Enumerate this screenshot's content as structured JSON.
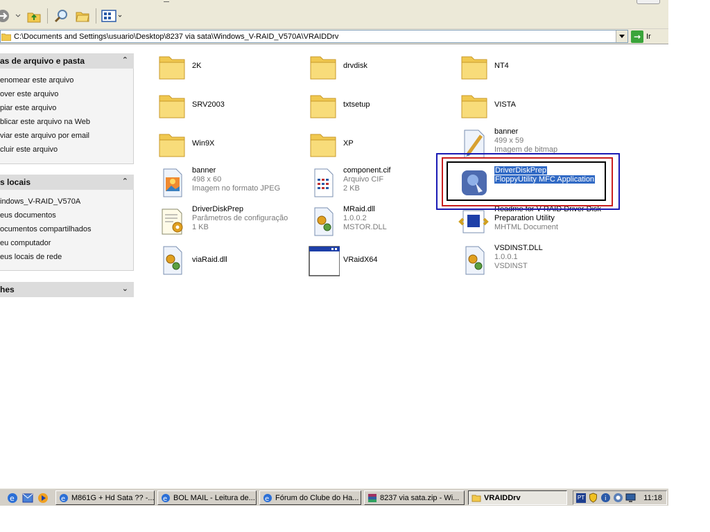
{
  "address": {
    "path": "C:\\Documents and Settings\\usuario\\Desktop\\8237 via sata\\Windows_V-RAID_V570A\\VRAIDDrv",
    "go_label": "Ir"
  },
  "taskpane": {
    "file_tasks": {
      "title": "as de arquivo e pasta",
      "items": [
        "enomear este arquivo",
        "over este arquivo",
        "piar este arquivo",
        "blicar este arquivo na Web",
        "viar este arquivo por email",
        "cluir este arquivo"
      ]
    },
    "other_places": {
      "title": "s locais",
      "items": [
        "indows_V-RAID_V570A",
        "eus documentos",
        "ocumentos compartilhados",
        "eu computador",
        "eus locais de rede"
      ]
    },
    "details": {
      "title": "hes"
    }
  },
  "files": [
    {
      "name": "2K"
    },
    {
      "name": "drvdisk"
    },
    {
      "name": "NT4"
    },
    {
      "name": "SRV2003"
    },
    {
      "name": "txtsetup"
    },
    {
      "name": "VISTA"
    },
    {
      "name": "Win9X"
    },
    {
      "name": "XP"
    },
    {
      "name": "banner",
      "sub1": "499 x 59",
      "sub2": "Imagem de bitmap"
    },
    {
      "name": "banner",
      "sub1": "498 x 60",
      "sub2": "Imagem no formato JPEG"
    },
    {
      "name": "component.cif",
      "sub1": "Arquivo CIF",
      "sub2": "2 KB"
    },
    {
      "name": "DriverDiskPrep",
      "sub1": "FloppyUtility MFC Application"
    },
    {
      "name": "DriverDiskPrep",
      "sub1": "Parâmetros de configuração",
      "sub2": "1 KB"
    },
    {
      "name": "MRaid.dll",
      "sub1": "1.0.0.2",
      "sub2": "MSTOR.DLL"
    },
    {
      "name": "Readme for V-RAID Driver Disk",
      "sub1": "Preparation Utility",
      "sub2": "MHTML Document"
    },
    {
      "name": "viaRaid.dll"
    },
    {
      "name": "VRaidX64"
    },
    {
      "name": "VSDINST.DLL",
      "sub1": "1.0.0.1",
      "sub2": "VSDINST"
    }
  ],
  "taskbar": {
    "buttons": [
      "M861G + Hd Sata ?? -...",
      "BOL MAIL - Leitura de...",
      "Fórum do Clube do Ha...",
      "8237 via sata.zip - Wi...",
      "VRAIDDrv"
    ],
    "lang": "PT",
    "clock": "11:18"
  },
  "colors": {
    "selection": "#316ac5",
    "annotation_blue": "#1a1ab4",
    "annotation_red": "#c81e1e",
    "annotation_black": "#000000"
  },
  "icons": {
    "toolbar": [
      "forward-icon",
      "up-folder-icon",
      "search-icon",
      "folders-icon",
      "views-icon"
    ]
  }
}
